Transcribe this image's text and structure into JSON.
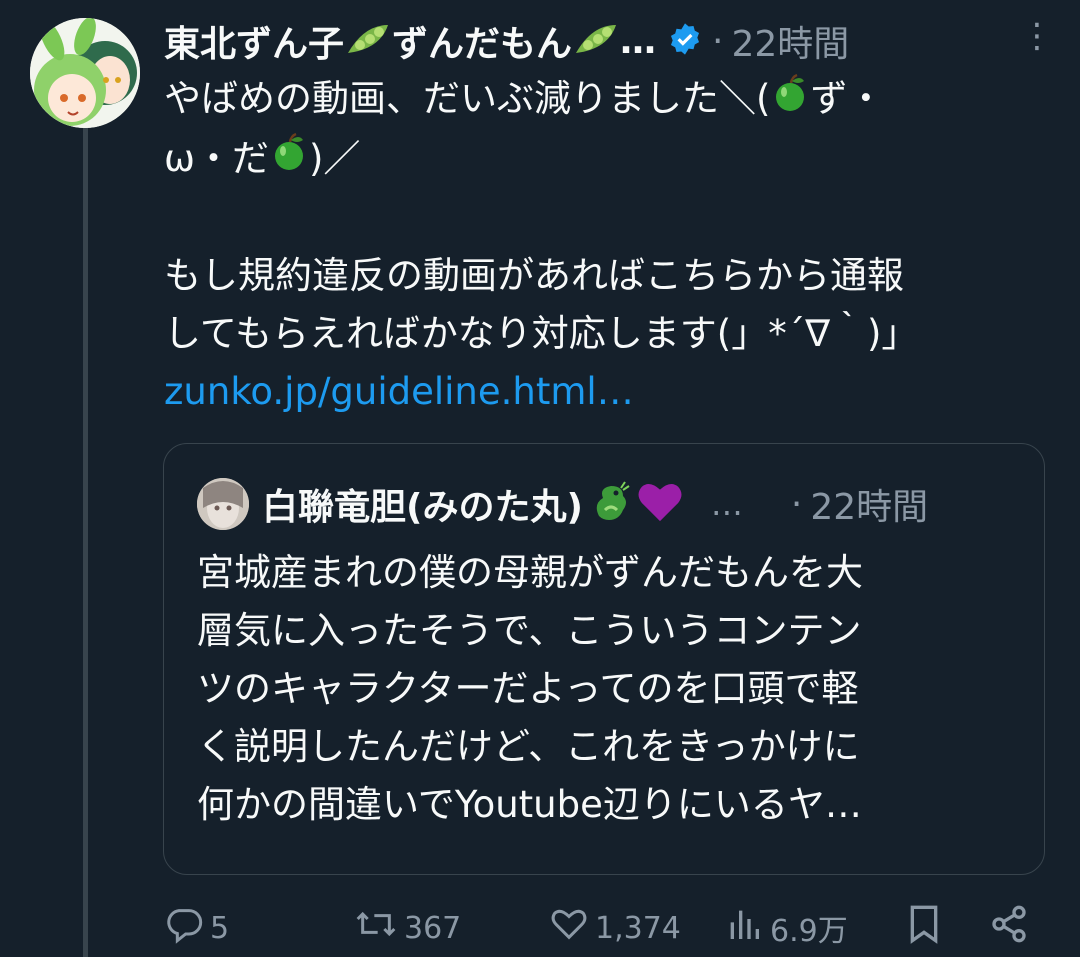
{
  "tweet": {
    "display_name": "東北ずん子",
    "display_name_2": "ずんだもん",
    "name_ellipsis": "…",
    "dot": "·",
    "time": "22時間",
    "more": "⋮",
    "text_line1": "やばめの動画、だいぶ減りました＼(",
    "text_line1b": "ず・",
    "text_line2": "ω・だ",
    "text_line2b": ")／",
    "text_line3": "もし規約違反の動画があればこちらから通報",
    "text_line4": "してもらえればかなり対応します(」*´∇｀)」",
    "link": "zunko.jp/guideline.html…"
  },
  "quote": {
    "display_name": "白聯竜胆(みのた丸)",
    "ellipsis": "…",
    "dot": "·",
    "time": "22時間",
    "lines": [
      "宮城産まれの僕の母親がずんだもんを大",
      "層気に入ったそうで、こういうコンテン",
      "ツのキャラクターだよってのを口頭で軽",
      "く説明したんだけど、これをきっかけに",
      "何かの間違いでYoutube辺りにいるヤ…"
    ]
  },
  "actions": {
    "reply_count": "5",
    "retweet_count": "367",
    "like_count": "1,374",
    "views_count": "6.9万"
  },
  "colors": {
    "background": "#15202b",
    "text": "#f7f9f9",
    "muted": "#8b98a5",
    "link": "#1d9bf0",
    "border": "#38444d",
    "verified": "#1d9bf0"
  },
  "icons": [
    "pea-pod-icon",
    "verified-badge-icon",
    "green-apple-icon",
    "dragon-icon",
    "purple-heart-icon",
    "reply-icon",
    "retweet-icon",
    "like-icon",
    "views-icon",
    "bookmark-icon",
    "share-icon",
    "more-icon"
  ]
}
